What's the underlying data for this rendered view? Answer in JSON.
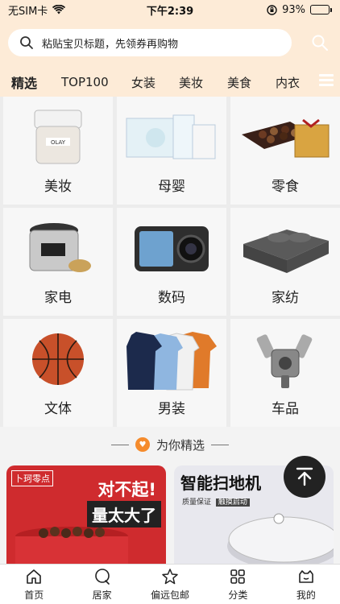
{
  "status_bar": {
    "carrier": "无SIM卡",
    "time": "下午2:39",
    "battery": "93%",
    "battery_level": 0.93,
    "wifi_icon": "wifi-icon",
    "lock_icon": "orientation-lock-icon"
  },
  "search": {
    "placeholder": "粘贴宝贝标题，先领券再购物",
    "icon": "search-icon"
  },
  "tabs": [
    "精选",
    "TOP100",
    "女装",
    "美妆",
    "美食",
    "内衣"
  ],
  "active_tab": "精选",
  "categories": [
    {
      "label": "美妆",
      "icon": "face-cream-jar"
    },
    {
      "label": "母婴",
      "icon": "diaper-packs"
    },
    {
      "label": "零食",
      "icon": "chocolate-box"
    },
    {
      "label": "家电",
      "icon": "pressure-cooker"
    },
    {
      "label": "数码",
      "icon": "action-camera"
    },
    {
      "label": "家纺",
      "icon": "bedding-set"
    },
    {
      "label": "文体",
      "icon": "basketball"
    },
    {
      "label": "男装",
      "icon": "polo-shirts"
    },
    {
      "label": "车品",
      "icon": "car-phone-holder"
    }
  ],
  "section": {
    "title": "为你精选"
  },
  "banners": {
    "left": {
      "brand": "卜珂零点",
      "promo_line1": "对不起!",
      "promo_line2": "量太大了"
    },
    "right": {
      "title": "智能扫地机",
      "tag": "质量保证",
      "tag_badge": "触摸启动"
    }
  },
  "bottom_nav": [
    {
      "label": "首页",
      "icon": "home-icon"
    },
    {
      "label": "居家",
      "icon": "chat-bubble-icon"
    },
    {
      "label": "偏远包邮",
      "icon": "star-icon"
    },
    {
      "label": "分类",
      "icon": "grid-icon"
    },
    {
      "label": "我的",
      "icon": "profile-icon"
    }
  ],
  "colors": {
    "header_bg": "#fdebd7",
    "accent_orange": "#f58b2c",
    "banner_red": "#cf2b2e"
  }
}
